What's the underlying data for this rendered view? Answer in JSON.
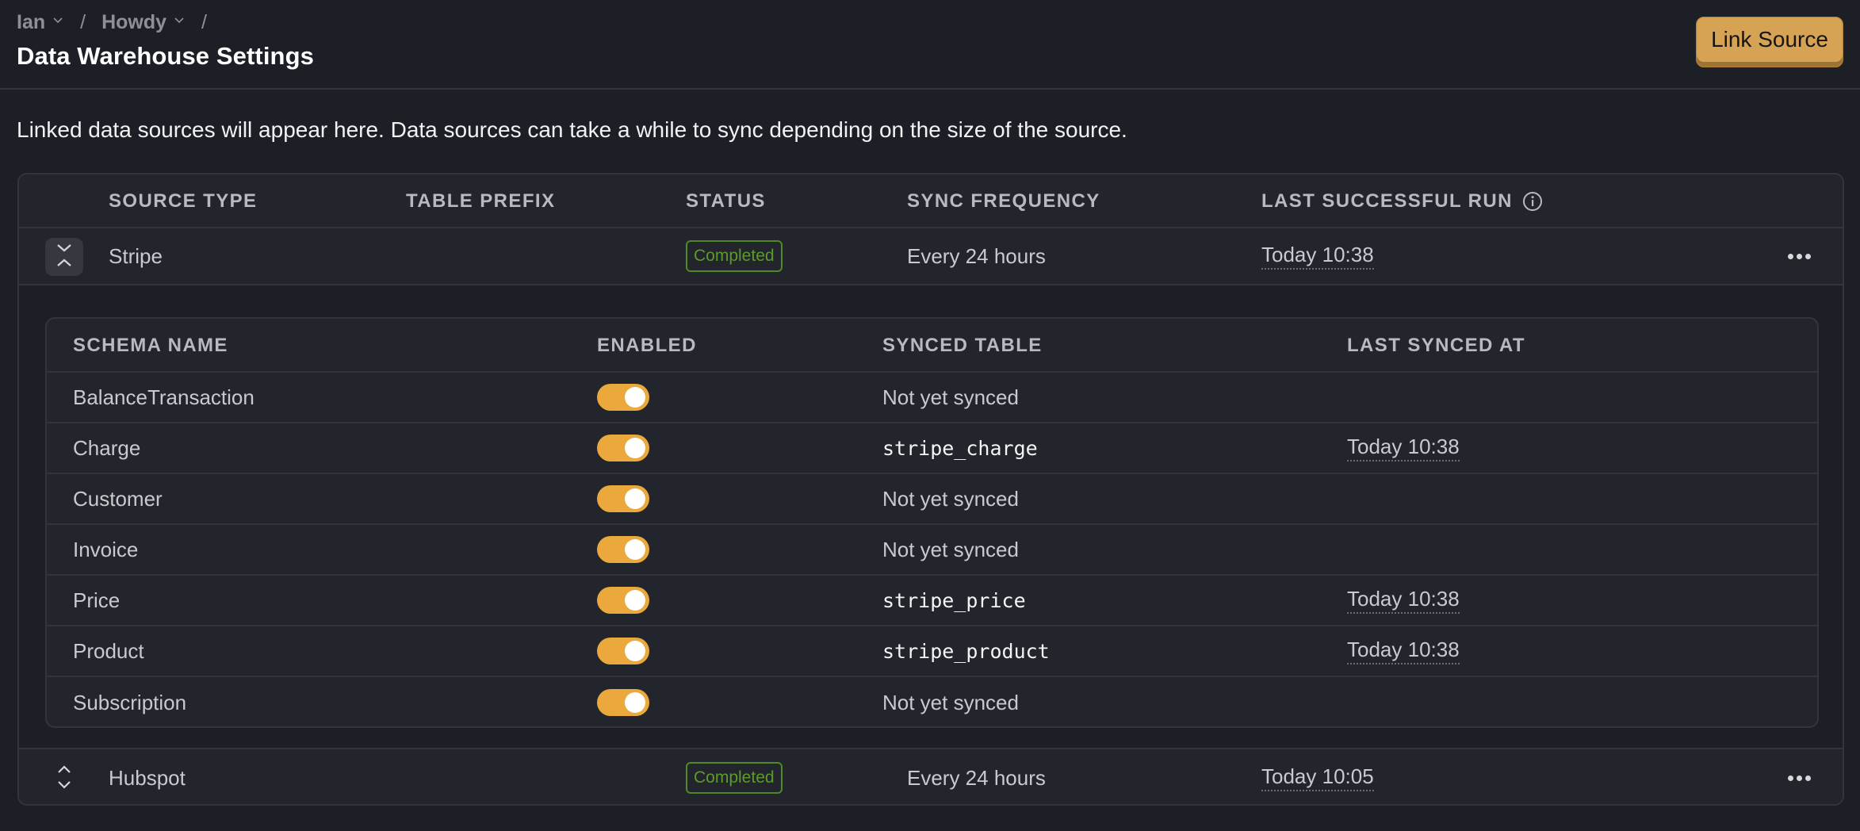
{
  "breadcrumb": [
    {
      "label": "Ian",
      "has_dropdown": true
    },
    {
      "label": "Howdy",
      "has_dropdown": true
    }
  ],
  "breadcrumb_separator": "/",
  "page_title": "Data Warehouse Settings",
  "link_source_label": "Link Source",
  "description": "Linked data sources will appear here. Data sources can take a while to sync depending on the size of the source.",
  "colors": {
    "accent": "#d6a254",
    "toggle_on": "#eba93d",
    "status_completed": "#5c9a2b",
    "background": "#1d1f27",
    "surface": "#23252c"
  },
  "sources_table": {
    "columns": [
      "SOURCE TYPE",
      "TABLE PREFIX",
      "STATUS",
      "SYNC FREQUENCY",
      "LAST SUCCESSFUL RUN"
    ],
    "info_icon": "info-icon",
    "rows": [
      {
        "source_type": "Stripe",
        "table_prefix": "",
        "status": "Completed",
        "sync_frequency": "Every 24 hours",
        "last_successful_run": "Today 10:38",
        "expanded": true,
        "schemas": {
          "columns": [
            "SCHEMA NAME",
            "ENABLED",
            "SYNCED TABLE",
            "LAST SYNCED AT"
          ],
          "rows": [
            {
              "name": "BalanceTransaction",
              "enabled": true,
              "synced_table": "Not yet synced",
              "synced_table_is_code": false,
              "last_synced_at": ""
            },
            {
              "name": "Charge",
              "enabled": true,
              "synced_table": "stripe_charge",
              "synced_table_is_code": true,
              "last_synced_at": "Today 10:38"
            },
            {
              "name": "Customer",
              "enabled": true,
              "synced_table": "Not yet synced",
              "synced_table_is_code": false,
              "last_synced_at": ""
            },
            {
              "name": "Invoice",
              "enabled": true,
              "synced_table": "Not yet synced",
              "synced_table_is_code": false,
              "last_synced_at": ""
            },
            {
              "name": "Price",
              "enabled": true,
              "synced_table": "stripe_price",
              "synced_table_is_code": true,
              "last_synced_at": "Today 10:38"
            },
            {
              "name": "Product",
              "enabled": true,
              "synced_table": "stripe_product",
              "synced_table_is_code": true,
              "last_synced_at": "Today 10:38"
            },
            {
              "name": "Subscription",
              "enabled": true,
              "synced_table": "Not yet synced",
              "synced_table_is_code": false,
              "last_synced_at": ""
            }
          ]
        }
      },
      {
        "source_type": "Hubspot",
        "table_prefix": "",
        "status": "Completed",
        "sync_frequency": "Every 24 hours",
        "last_successful_run": "Today 10:05",
        "expanded": false
      }
    ]
  }
}
